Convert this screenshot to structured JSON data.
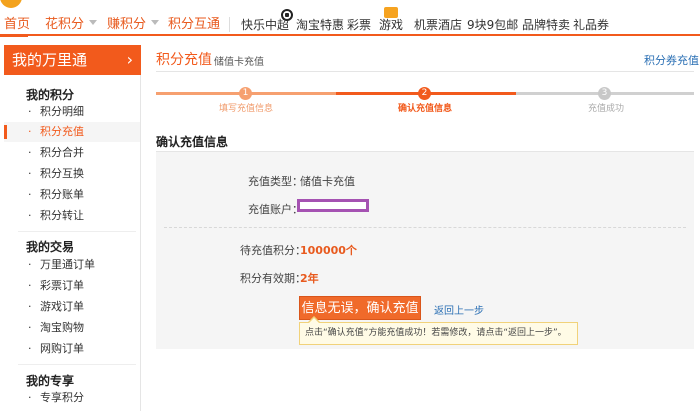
{
  "topnav": {
    "items": [
      {
        "label": "首页"
      },
      {
        "label": "花积分"
      },
      {
        "label": "赚积分"
      },
      {
        "label": "积分互通"
      },
      {
        "label": "快乐中超"
      },
      {
        "label": "淘宝特惠"
      },
      {
        "label": "彩票"
      },
      {
        "label": "游戏"
      },
      {
        "label": "机票酒店"
      },
      {
        "label": "9块9包邮"
      },
      {
        "label": "品牌特卖"
      },
      {
        "label": "礼品券"
      }
    ]
  },
  "sidebar": {
    "title": "我的万里通",
    "groups": [
      {
        "title": "我的积分",
        "items": [
          "积分明细",
          "积分充值",
          "积分合并",
          "积分互换",
          "积分账单",
          "积分转让"
        ]
      },
      {
        "title": "我的交易",
        "items": [
          "万里通订单",
          "彩票订单",
          "游戏订单",
          "淘宝购物",
          "网购订单"
        ]
      },
      {
        "title": "我的专享",
        "items": [
          "专享积分"
        ]
      }
    ],
    "active_item": "积分充值"
  },
  "main": {
    "title": "积分充值",
    "subtitle": "储值卡充值",
    "top_link": "积分券充值",
    "steps": [
      {
        "num": "1",
        "label": "填写充值信息"
      },
      {
        "num": "2",
        "label": "确认充值信息"
      },
      {
        "num": "3",
        "label": "充值成功"
      }
    ],
    "section_title": "确认充值信息",
    "rows": {
      "type_label": "充值类型：",
      "type_value": "储值卡充值",
      "account_label": "充值账户：",
      "points_label": "待充值积分：",
      "points_value": "100000个",
      "validity_label": "积分有效期：",
      "validity_value": "2年"
    },
    "confirm_button": "信息无误，确认充值",
    "back_link": "返回上一步",
    "tip": "点击“确认充值”方能充值成功！若需修改，请点击“返回上一步”。"
  },
  "colors": {
    "accent": "#f25a1c",
    "link": "#2a6fb4",
    "highlight_box": "#a552b2"
  }
}
